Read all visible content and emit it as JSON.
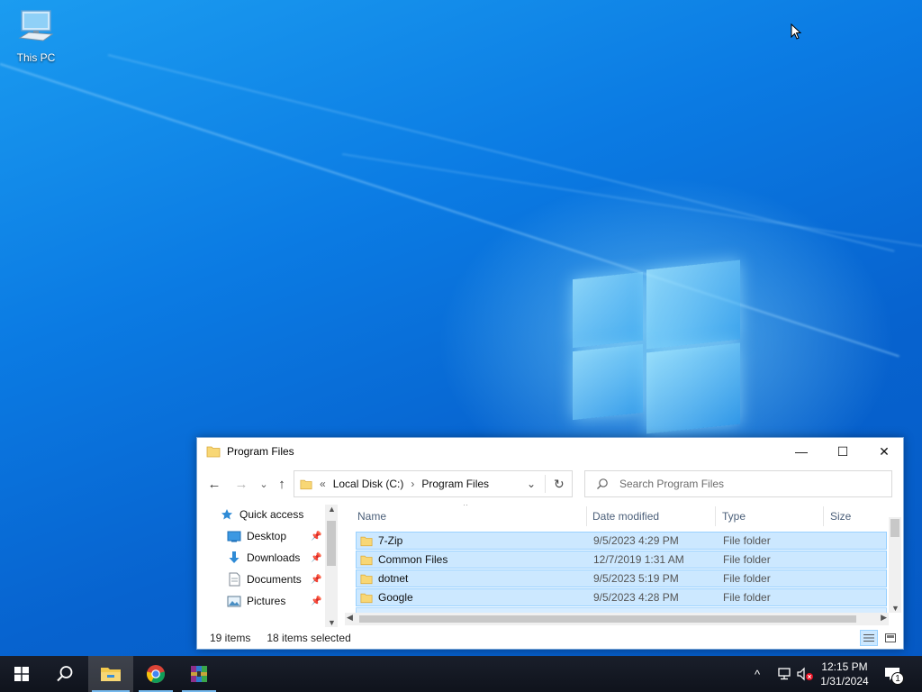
{
  "desktop": {
    "icons": [
      {
        "label": "This PC",
        "icon": "computer-icon"
      }
    ]
  },
  "explorer": {
    "title": "Program Files",
    "controls": {
      "minimize": "—",
      "maximize": "☐",
      "close": "✕"
    },
    "nav": {
      "back": "←",
      "forward": "→",
      "recent": "⌄",
      "up": "↑"
    },
    "address": {
      "overflow": "«",
      "crumbs": [
        "Local Disk (C:)",
        "Program Files"
      ],
      "sep": "›",
      "dropdown": "⌄",
      "refresh": "↻"
    },
    "search": {
      "placeholder": "Search Program Files"
    },
    "nav_pane": [
      {
        "label": "Quick access",
        "icon": "star-icon",
        "pinned": false
      },
      {
        "label": "Desktop",
        "icon": "desktop-icon",
        "pinned": true
      },
      {
        "label": "Downloads",
        "icon": "download-icon",
        "pinned": true
      },
      {
        "label": "Documents",
        "icon": "document-icon",
        "pinned": true
      },
      {
        "label": "Pictures",
        "icon": "picture-icon",
        "pinned": true
      }
    ],
    "columns": [
      "Name",
      "Date modified",
      "Type",
      "Size"
    ],
    "rows": [
      {
        "name": "7-Zip",
        "date": "9/5/2023 4:29 PM",
        "type": "File folder",
        "size": ""
      },
      {
        "name": "Common Files",
        "date": "12/7/2019 1:31 AM",
        "type": "File folder",
        "size": ""
      },
      {
        "name": "dotnet",
        "date": "9/5/2023 5:19 PM",
        "type": "File folder",
        "size": ""
      },
      {
        "name": "Google",
        "date": "9/5/2023 4:28 PM",
        "type": "File folder",
        "size": ""
      }
    ],
    "status": {
      "items": "19 items",
      "selected": "18 items selected"
    }
  },
  "taskbar": {
    "apps": [
      "start-icon",
      "search-icon",
      "file-explorer-icon",
      "chrome-icon",
      "winrar-icon"
    ],
    "tray": {
      "chevron": "^",
      "time": "12:15 PM",
      "date": "1/31/2024",
      "notifications": "1"
    }
  },
  "colors": {
    "selection": "#cce8ff",
    "selection_border": "#99d1ff",
    "taskbar": "#141a26",
    "accent": "#76b9ed"
  }
}
